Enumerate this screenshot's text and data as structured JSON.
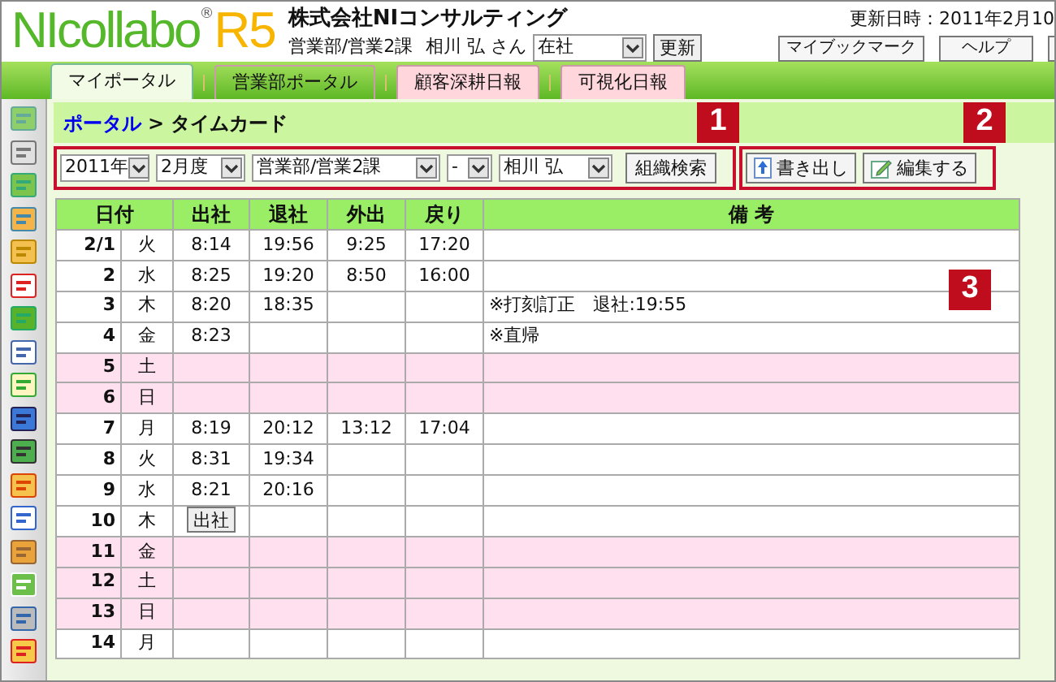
{
  "logo": {
    "main": "NIcollabo",
    "mark": "®",
    "version": "R5"
  },
  "company": "株式会社NIコンサルティング",
  "user": {
    "department": "営業部/営業2課",
    "name": "相川 弘 さん"
  },
  "presence_select": {
    "value": "在社"
  },
  "refresh_button": "更新",
  "updated": "更新日時：2011年2月10",
  "header_buttons": [
    "マイブックマーク",
    "ヘルプ"
  ],
  "tabs": [
    {
      "label": "マイポータル",
      "selected": true,
      "color": "#f2fbe6"
    },
    {
      "label": "営業部ポータル",
      "selected": false,
      "color": "#7ccd35"
    },
    {
      "label": "顧客深耕日報",
      "selected": false,
      "color": "#ffd6dc"
    },
    {
      "label": "可視化日報",
      "selected": false,
      "color": "#ffd6dc"
    }
  ],
  "breadcrumb": {
    "link": "ポータル",
    "separator": ">",
    "current": "タイムカード"
  },
  "filters": [
    {
      "value": "2011年"
    },
    {
      "value": "2月度"
    },
    {
      "value": "営業部/営業2課"
    },
    {
      "value": "-"
    },
    {
      "value": "相川 弘"
    }
  ],
  "search_button": "組織検索",
  "actions": [
    {
      "label": "書き出し",
      "kind": "export"
    },
    {
      "label": "編集する",
      "kind": "edit"
    }
  ],
  "callouts": [
    "1",
    "2",
    "3"
  ],
  "table": {
    "columns": [
      "日付",
      "出社",
      "退社",
      "外出",
      "戻り",
      "備 考"
    ],
    "rows": [
      {
        "date": "2/1",
        "weekday": "火",
        "holiday": false,
        "in": "8:14",
        "out": "19:56",
        "away": "9:25",
        "back": "17:20"
      },
      {
        "date": "2",
        "weekday": "水",
        "holiday": false,
        "in": "8:25",
        "out": "19:20",
        "away": "8:50",
        "back": "16:00"
      },
      {
        "date": "3",
        "weekday": "木",
        "holiday": false,
        "in": "8:20",
        "out": "18:35",
        "note": "※打刻訂正　退社:19:55"
      },
      {
        "date": "4",
        "weekday": "金",
        "holiday": false,
        "in": "8:23",
        "note": "※直帰"
      },
      {
        "date": "5",
        "weekday": "土",
        "holiday": true
      },
      {
        "date": "6",
        "weekday": "日",
        "holiday": true
      },
      {
        "date": "7",
        "weekday": "月",
        "holiday": false,
        "in": "8:19",
        "out": "20:12",
        "away": "13:12",
        "back": "17:04"
      },
      {
        "date": "8",
        "weekday": "火",
        "holiday": false,
        "in": "8:31",
        "out": "19:34"
      },
      {
        "date": "9",
        "weekday": "水",
        "holiday": false,
        "in": "8:21",
        "out": "20:16"
      },
      {
        "date": "10",
        "weekday": "木",
        "holiday": false,
        "in_button": "出社"
      },
      {
        "date": "11",
        "weekday": "金",
        "holiday": true
      },
      {
        "date": "12",
        "weekday": "土",
        "holiday": true
      },
      {
        "date": "13",
        "weekday": "日",
        "holiday": true
      },
      {
        "date": "14",
        "weekday": "月",
        "holiday": false
      }
    ]
  }
}
